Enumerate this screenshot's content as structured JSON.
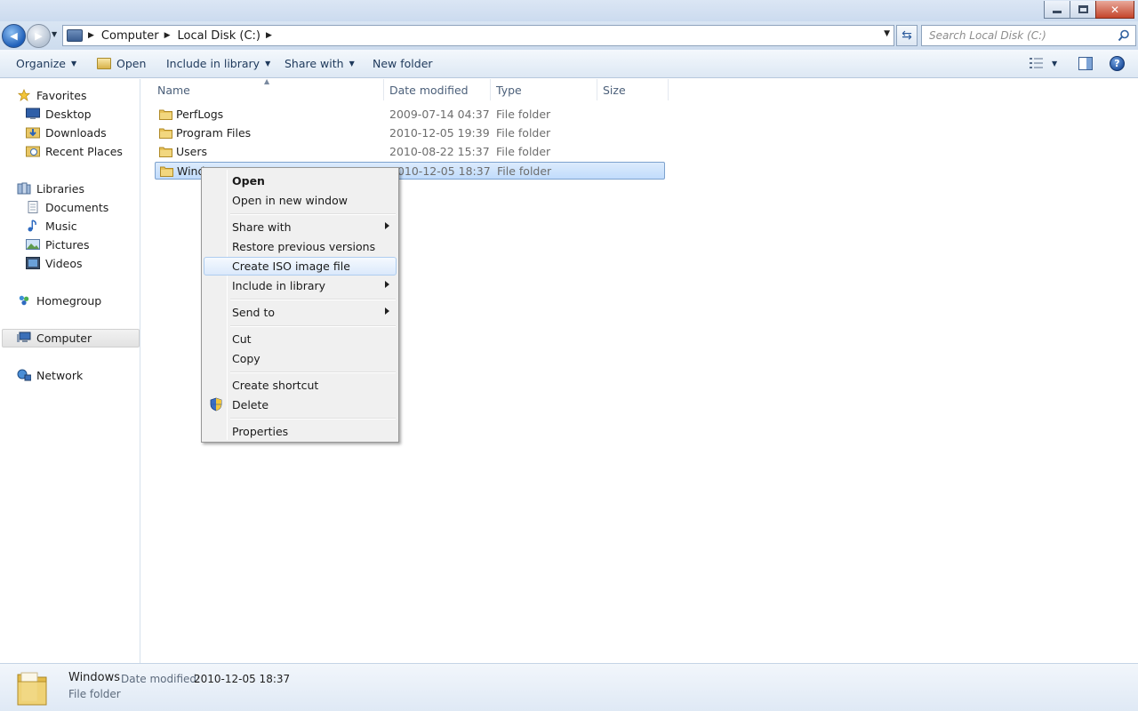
{
  "window": {
    "close_glyph": "✕"
  },
  "nav": {
    "back_glyph": "◀",
    "forward_glyph": "▶",
    "breadcrumbs": [
      "Computer",
      "Local Disk (C:)"
    ],
    "search_placeholder": "Search Local Disk (C:)"
  },
  "toolbar": {
    "organize": "Organize",
    "open": "Open",
    "include_in_library": "Include in library",
    "share_with": "Share with",
    "new_folder": "New folder",
    "help": "?"
  },
  "sidebar": {
    "favorites": "Favorites",
    "desktop": "Desktop",
    "downloads": "Downloads",
    "recent_places": "Recent Places",
    "libraries": "Libraries",
    "documents": "Documents",
    "music": "Music",
    "pictures": "Pictures",
    "videos": "Videos",
    "homegroup": "Homegroup",
    "computer": "Computer",
    "network": "Network"
  },
  "columns": {
    "name": "Name",
    "date_modified": "Date modified",
    "type": "Type",
    "size": "Size"
  },
  "files": [
    {
      "name": "PerfLogs",
      "date": "2009-07-14 04:37",
      "type": "File folder"
    },
    {
      "name": "Program Files",
      "date": "2010-12-05 19:39",
      "type": "File folder"
    },
    {
      "name": "Users",
      "date": "2010-08-22 15:37",
      "type": "File folder"
    },
    {
      "name": "Wind",
      "date": "2010-12-05 18:37",
      "type": "File folder"
    }
  ],
  "context_menu": {
    "open": "Open",
    "open_new_window": "Open in new window",
    "share_with": "Share with",
    "restore_previous": "Restore previous versions",
    "create_iso": "Create ISO image file",
    "include_in_library": "Include in library",
    "send_to": "Send to",
    "cut": "Cut",
    "copy": "Copy",
    "create_shortcut": "Create shortcut",
    "delete": "Delete",
    "properties": "Properties"
  },
  "details": {
    "name": "Windows",
    "date_label": "Date modified:",
    "date_value": "2010-12-05 18:37",
    "type": "File folder"
  },
  "colors": {
    "selection": "#c1dcfc",
    "accent": "#1e395b"
  }
}
